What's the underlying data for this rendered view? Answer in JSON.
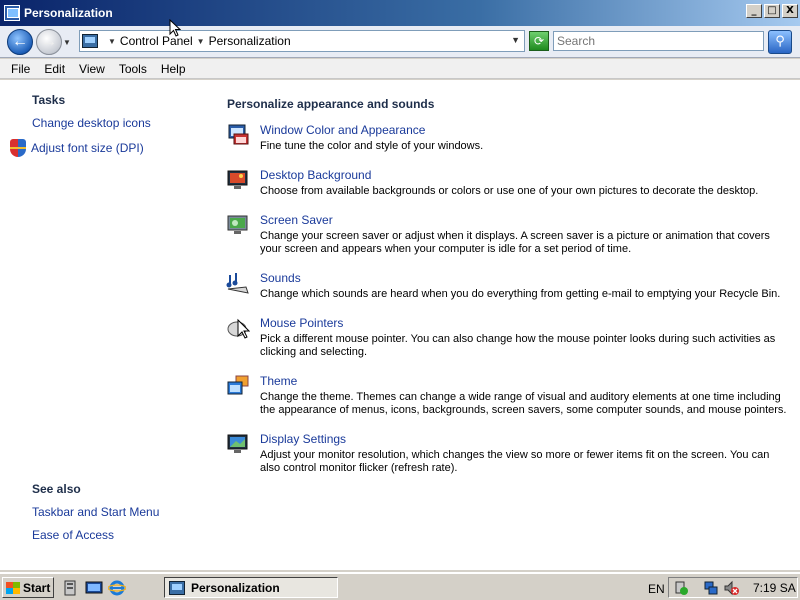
{
  "window": {
    "title": "Personalization"
  },
  "window_controls": {
    "minimize": "_",
    "maximize": "□",
    "close": "X"
  },
  "address_bar": {
    "breadcrumbs": [
      "Control Panel",
      "Personalization"
    ],
    "search_placeholder": "Search"
  },
  "menu": [
    "File",
    "Edit",
    "View",
    "Tools",
    "Help"
  ],
  "sidebar": {
    "tasks_heading": "Tasks",
    "tasks": [
      "Change desktop icons",
      "Adjust font size (DPI)"
    ],
    "see_also_heading": "See also",
    "see_also": [
      "Taskbar and Start Menu",
      "Ease of Access"
    ]
  },
  "main": {
    "heading": "Personalize appearance and sounds",
    "items": [
      {
        "title": "Window Color and Appearance",
        "desc": "Fine tune the color and style of your windows.",
        "icon": "window-color-icon"
      },
      {
        "title": "Desktop Background",
        "desc": "Choose from available backgrounds or colors or use one of your own pictures to decorate the desktop.",
        "icon": "desktop-background-icon"
      },
      {
        "title": "Screen Saver",
        "desc": "Change your screen saver or adjust when it displays. A screen saver is a picture or animation that covers your screen and appears when your computer is idle for a set period of time.",
        "icon": "screen-saver-icon"
      },
      {
        "title": "Sounds",
        "desc": "Change which sounds are heard when you do everything from getting e-mail to emptying your Recycle Bin.",
        "icon": "sounds-icon"
      },
      {
        "title": "Mouse Pointers",
        "desc": "Pick a different mouse pointer. You can also change how the mouse pointer looks during such activities as clicking and selecting.",
        "icon": "mouse-pointers-icon"
      },
      {
        "title": "Theme",
        "desc": "Change the theme. Themes can change a wide range of visual and auditory elements at one time including the appearance of menus, icons, backgrounds, screen savers, some computer sounds, and mouse pointers.",
        "icon": "theme-icon"
      },
      {
        "title": "Display Settings",
        "desc": "Adjust your monitor resolution, which changes the view so more or fewer items fit on the screen. You can also control monitor flicker (refresh rate).",
        "icon": "display-settings-icon"
      }
    ]
  },
  "taskbar": {
    "start_label": "Start",
    "active_window": "Personalization",
    "language": "EN",
    "clock": "7:19 SA"
  }
}
